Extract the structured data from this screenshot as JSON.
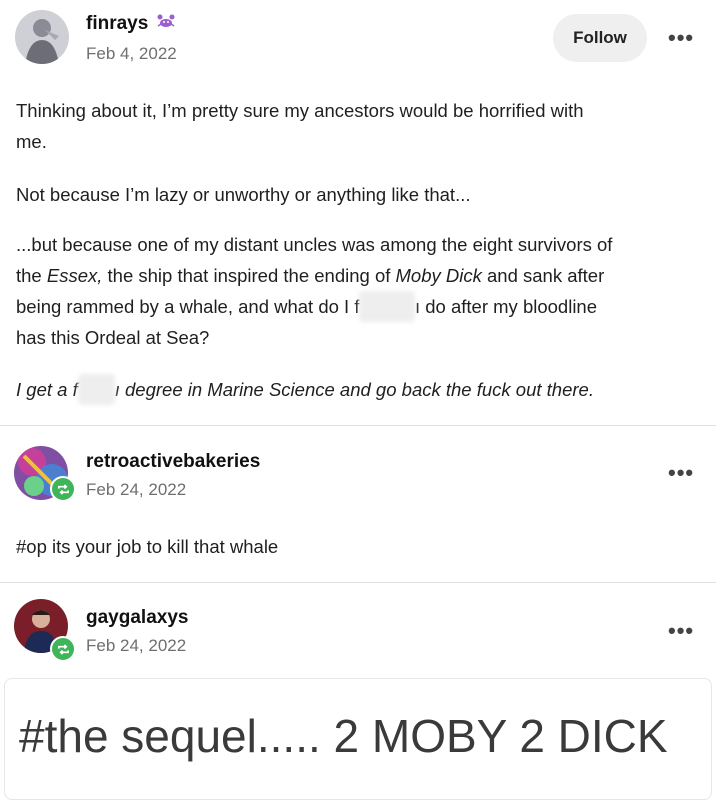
{
  "post1": {
    "username": "finrays",
    "date": "Feb 4, 2022",
    "follow_label": "Follow",
    "more_label": "•••",
    "para1_line1": "Thinking about it, I’m pretty sure my ancestors would be horrified with",
    "para1_line2": "me.",
    "para2": "Not because I’m lazy or unworthy or anything like that...",
    "para3_a": "...but because one of my distant uncles was among the eight survivors of",
    "para3_b_pre": "the ",
    "para3_b_em1": "Essex,",
    "para3_b_mid": " the ship that inspired the ending of ",
    "para3_b_em2": "Moby Dick",
    "para3_b_post": " and sank after",
    "para3_c_pre": "being rammed by a whale, and what do I f",
    "para3_c_post": "ı do after my bloodline",
    "para3_d": "has this Ordeal at Sea?",
    "para4_pre": "I get a f",
    "para4_post": "ı degree in Marine Science and go back the fuck out there."
  },
  "post2": {
    "username": "retroactivebakeries",
    "date": "Feb 24, 2022",
    "more_label": "•••",
    "tag": "#op its your job to kill that whale"
  },
  "post3": {
    "username": "gaygalaxys",
    "date": "Feb 24, 2022",
    "more_label": "•••",
    "big_tag": "#the sequel..... 2 MOBY 2 DICK"
  },
  "colors": {
    "badge": "#3fb55a",
    "divider": "#e1e1e1",
    "follow_bg": "#efefef"
  }
}
